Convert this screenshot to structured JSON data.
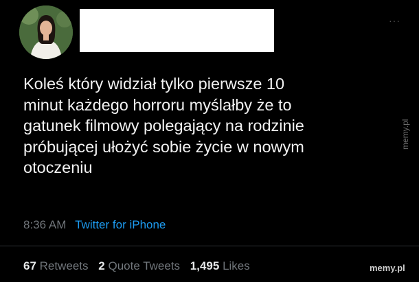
{
  "tweet": {
    "text": "Koleś który widział tylko pierwsze 10\nminut każdego horroru myślałby że to\ngatunek filmowy polegający na rodzinie\npróbującej ułożyć sobie życie w nowym\notoczeniu",
    "time": "8:36 AM",
    "source": "Twitter for iPhone"
  },
  "stats": {
    "retweets_count": "67",
    "retweets_label": "Retweets",
    "quotes_count": "2",
    "quotes_label": "Quote Tweets",
    "likes_count": "1,495",
    "likes_label": "Likes"
  },
  "more_icon": "···",
  "watermark": "memy.pl",
  "colors": {
    "background": "#000000",
    "link": "#1d9bf0",
    "muted": "#71767b"
  }
}
